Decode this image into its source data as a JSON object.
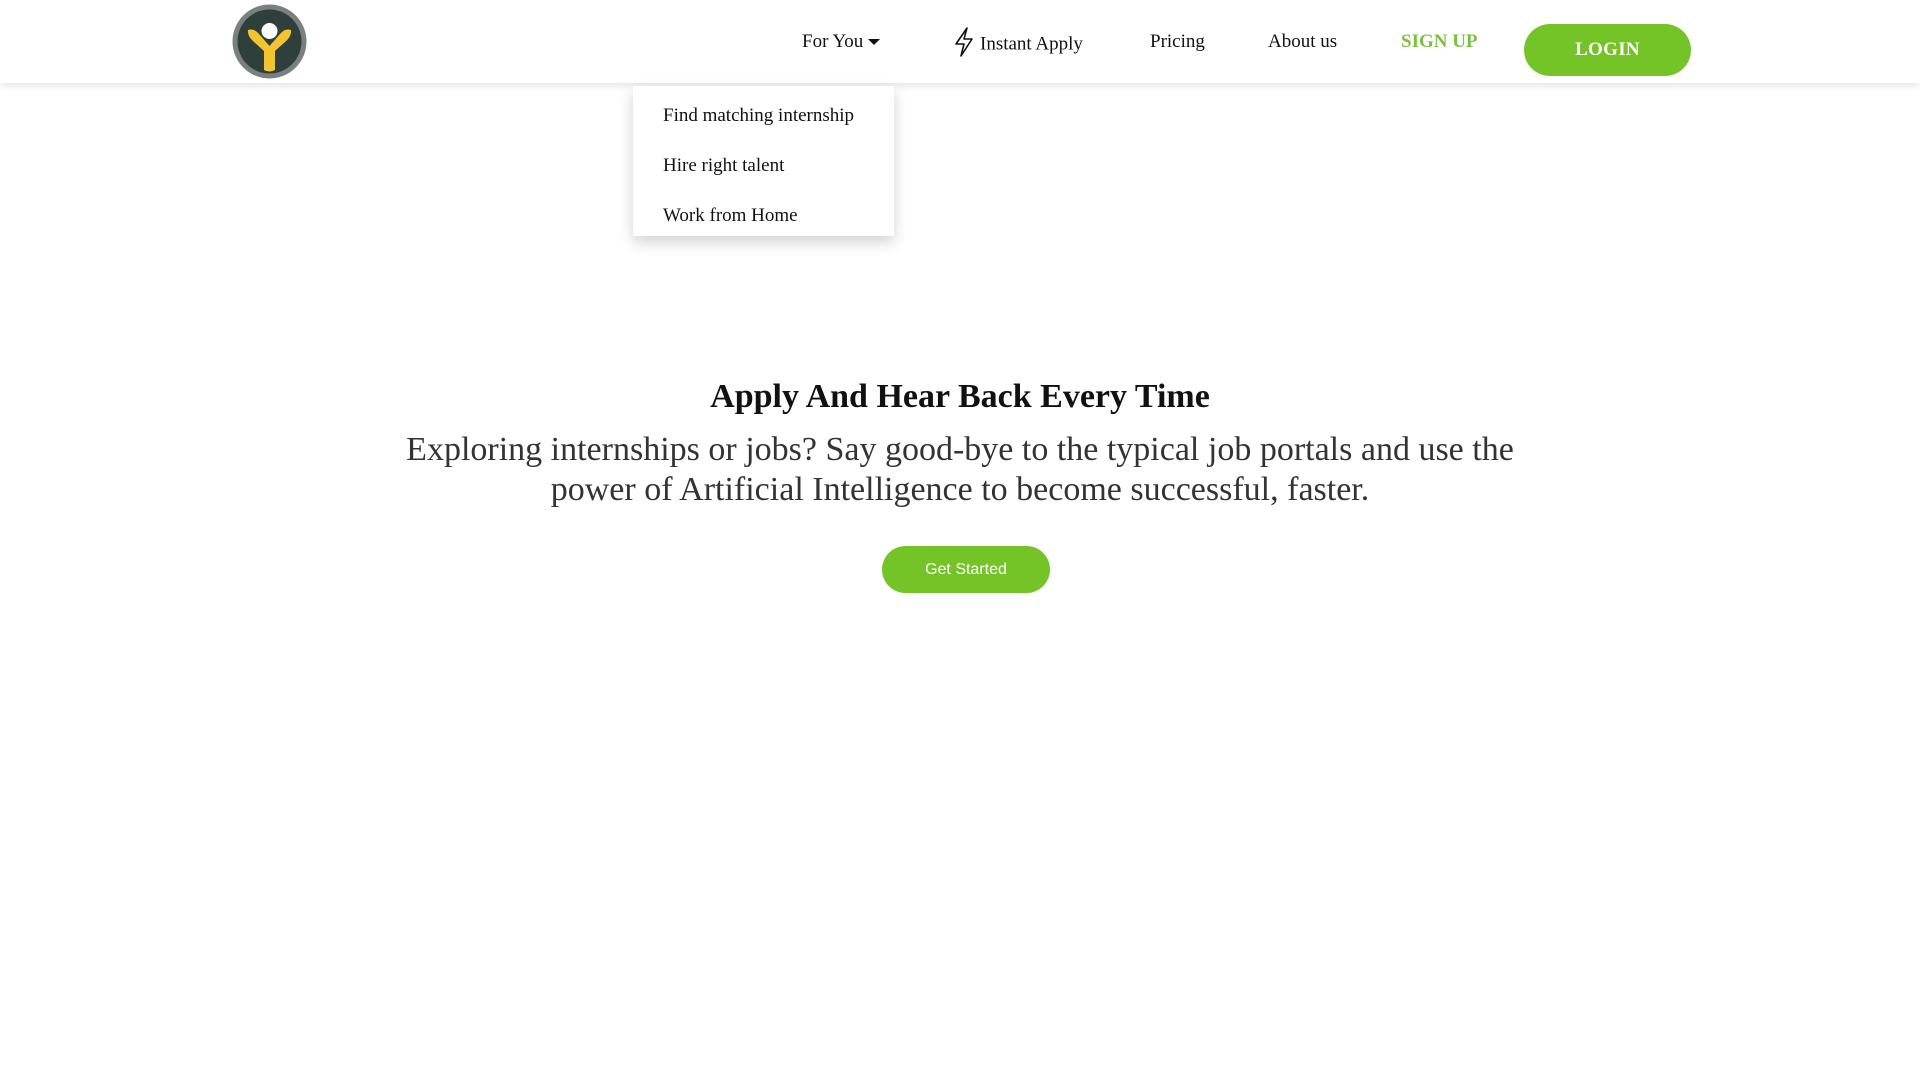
{
  "brand": {
    "logo_icon": "person-circle-logo",
    "colors": {
      "accent_green": "#75c427",
      "logo_ring": "#7a7f80",
      "logo_dark": "#2e3f3c",
      "logo_yellow": "#f4c430"
    }
  },
  "nav": {
    "for_you": {
      "label": "For You",
      "icon": "caret-down-icon"
    },
    "instant_apply": {
      "label": "Instant Apply",
      "icon": "lightning-bolt-icon"
    },
    "pricing": {
      "label": "Pricing"
    },
    "about": {
      "label": "About us"
    },
    "signup": {
      "label": "SIGN UP"
    },
    "login": {
      "label": "LOGIN"
    }
  },
  "dropdown": {
    "items": [
      {
        "label": "Find matching internship"
      },
      {
        "label": "Hire right talent"
      },
      {
        "label": "Work from Home"
      }
    ]
  },
  "hero": {
    "title": "Apply And Hear Back Every Time",
    "subtitle": "Exploring internships or jobs? Say good-bye to the typical job portals and use the power of Artificial Intelligence to become successful, faster.",
    "cta_label": "Get Started"
  }
}
